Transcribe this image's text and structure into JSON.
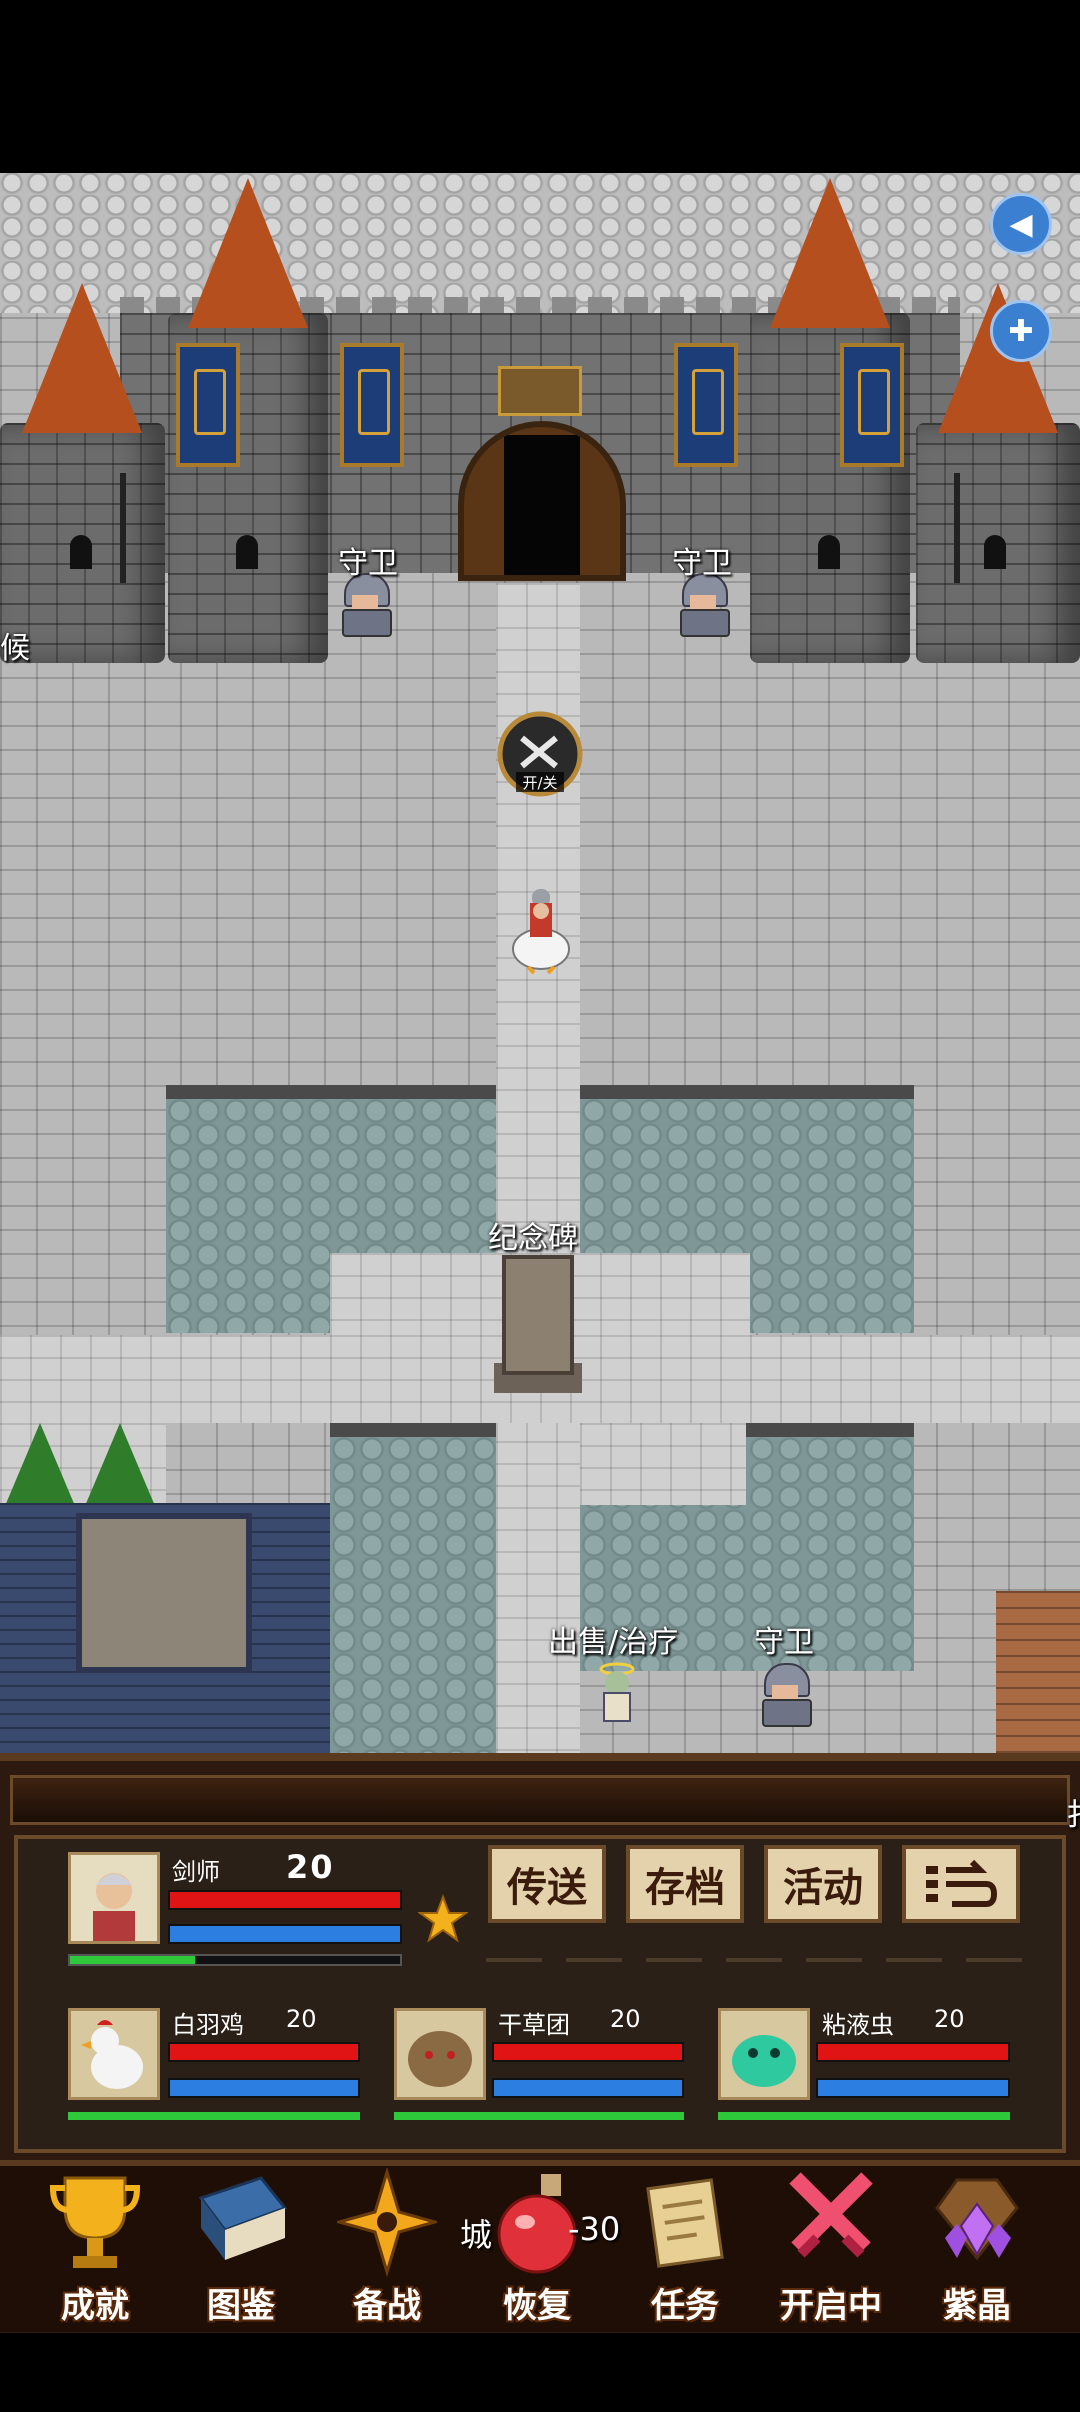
{
  "map": {
    "npc_labels": {
      "guard_left": "守卫",
      "guard_right": "守卫",
      "guard_bottom": "守卫",
      "merchant": "出售/治疗",
      "monument": "纪念碑",
      "edge_left": "候",
      "edge_right": "扌"
    },
    "toggle_badge": "开/关"
  },
  "party": {
    "leader": {
      "name": "剑师",
      "level": "20",
      "hp_fraction": 1.0,
      "mp_fraction": 1.0,
      "xp_fraction": 0.38
    },
    "pets": [
      {
        "name": "白羽鸡",
        "level": "20",
        "hp_fraction": 1.0,
        "mp_fraction": 1.0
      },
      {
        "name": "干草团",
        "level": "20",
        "hp_fraction": 1.0,
        "mp_fraction": 1.0
      },
      {
        "name": "粘液虫",
        "level": "20",
        "hp_fraction": 1.0,
        "mp_fraction": 1.0
      }
    ]
  },
  "actions": {
    "teleport": "传送",
    "save": "存档",
    "events": "活动",
    "more_icon": "exit-arrow-icon"
  },
  "floating_text": {
    "left": "城",
    "right": "-30"
  },
  "bottom_nav": [
    {
      "label": "成就",
      "icon": "trophy-icon"
    },
    {
      "label": "图鉴",
      "icon": "book-icon"
    },
    {
      "label": "备战",
      "icon": "shuriken-icon"
    },
    {
      "label": "恢复",
      "icon": "potion-icon"
    },
    {
      "label": "任务",
      "icon": "scroll-icon"
    },
    {
      "label": "开启中",
      "icon": "crossed-swords-icon"
    },
    {
      "label": "紫晶",
      "icon": "amethyst-icon"
    }
  ],
  "colors": {
    "hp": "#e01414",
    "mp": "#2c7fe0",
    "xp": "#2ec93a",
    "panel": "#2c1a10"
  }
}
